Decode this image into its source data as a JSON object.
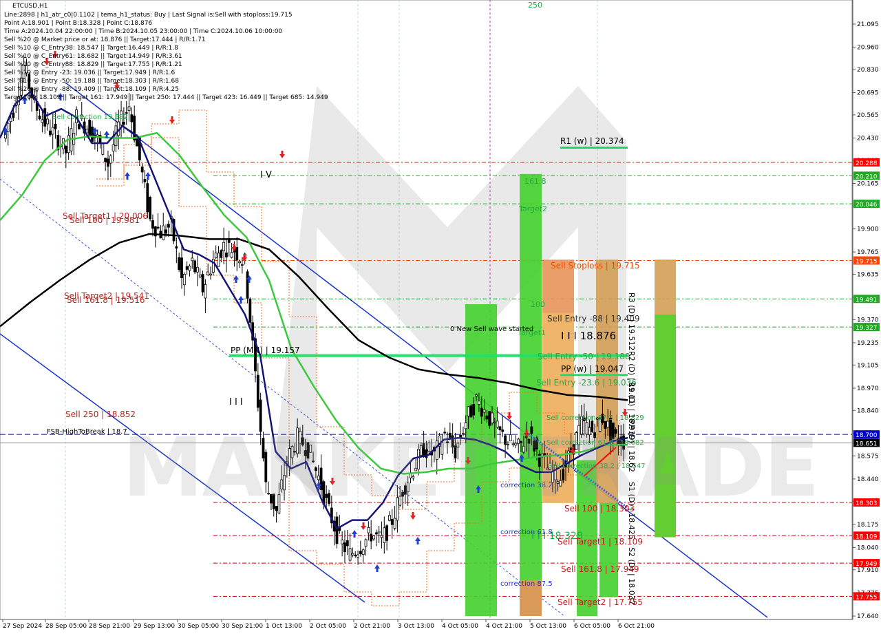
{
  "chart_data": {
    "type": "line",
    "title": "ETCUSD,H1",
    "info_lines": [
      "Line:2898 | h1_atr_c0|0.1102 | tema_h1_status: Buy | Last Signal is:Sell with stoploss:19.715",
      "Point A:18.901 | Point B:18.328 | Point C:18.876",
      "Time A:2024.10.04 22:00:00 | Time B:2024.10.05 23:00:00 | Time C:2024.10.06 10:00:00",
      "Sell %20 @ Market price or at: 18.876 || Target:17.444 | R/R:1.71",
      "Sell %10 @ C_Entry38: 18.547 || Target:16.449 | R/R:1.8",
      "Sell %10 @ C_Entry61: 18.682 || Target:14.949 | R/R:3.61",
      "Sell %10 @ C_Entry88: 18.829 || Target:17.755 | R/R:1.21",
      "Sell %10 @ Entry -23: 19.036 || Target:17.949 | R/R:1.6",
      "Sell %10 @ Entry -50: 19.188 || Target:18.303 | R/R:1.68",
      "Sell %20 @ Entry -88: 19.409 || Target:18.109 | R/R:4.25",
      "Target100: 18.109 || Target 161: 17.949 || Target 250: 17.444 || Target 423: 16.449 || Target 685: 14.949"
    ],
    "x_labels": [
      "27 Sep 2024",
      "28 Sep 05:00",
      "28 Sep 21:00",
      "29 Sep 13:00",
      "30 Sep 05:00",
      "30 Sep 21:00",
      "1 Oct 13:00",
      "2 Oct 05:00",
      "2 Oct 21:00",
      "3 Oct 13:00",
      "4 Oct 05:00",
      "4 Oct 21:00",
      "5 Oct 13:00",
      "6 Oct 05:00",
      "6 Oct 21:00"
    ],
    "y_ticks": [
      21.095,
      20.96,
      20.83,
      20.695,
      20.565,
      20.43,
      20.3,
      20.165,
      20.035,
      19.9,
      19.765,
      19.635,
      19.5,
      19.37,
      19.235,
      19.105,
      18.97,
      18.84,
      18.705,
      18.575,
      18.44,
      18.31,
      18.175,
      18.04,
      17.91,
      17.775,
      17.64
    ],
    "price_tags": [
      {
        "label": "20.288",
        "value": 20.288,
        "color": "#ff0000"
      },
      {
        "label": "20.210",
        "value": 20.21,
        "color": "#22aa22"
      },
      {
        "label": "20.046",
        "value": 20.046,
        "color": "#22aa22"
      },
      {
        "label": "19.715",
        "value": 19.715,
        "color": "#ff4500"
      },
      {
        "label": "19.491",
        "value": 19.491,
        "color": "#22aa22"
      },
      {
        "label": "19.327",
        "value": 19.327,
        "color": "#22aa22"
      },
      {
        "label": "18.700",
        "value": 18.7,
        "color": "#0000cd"
      },
      {
        "label": "18.651",
        "value": 18.651,
        "color": "#000000"
      },
      {
        "label": "18.303",
        "value": 18.303,
        "color": "#ff0000"
      },
      {
        "label": "18.109",
        "value": 18.109,
        "color": "#ff0000"
      },
      {
        "label": "17.949",
        "value": 17.949,
        "color": "#ff0000"
      },
      {
        "label": "17.755",
        "value": 17.755,
        "color": "#ff0000"
      }
    ],
    "annotations": {
      "r1_week": "R1 (w) | 20.374",
      "pp_month": "PP (MN) | 19.157",
      "pp_week": "PP (w) | 19.047",
      "sell_target1_top": "Sell Target1 | 20.006",
      "sell_100_top": "Sell 100 | 19.981",
      "sell_target2_top": "Sell Target2 | 19.541",
      "sell_161_top": "Sell 161.8 | 19.516",
      "sell_250": "Sell  250 | 18.852",
      "fsb": "FSB-HighToBreak | 18.7",
      "sell_stoploss": "Sell Stoploss | 19.715",
      "sell_entry_88": "Sell Entry -88 | 19.409",
      "sell_entry_50": "Sell Entry -50 | 19.188",
      "sell_entry_23": "Sell Entry -23.6 | 19.036",
      "point_c": "I I I 18.876",
      "point_b": "I I I 18.328",
      "sell_correction_87": "Sell correction 87.5 | 18.829",
      "sell_correction_61": "Sell correction 61.8 | 18.682",
      "sell_correction_38": "Sell correction 38.2 | 18.547",
      "sell_100_bottom": "Sell 100 | 18.303",
      "sell_target1_bottom": "Sell Target1 | 18.109",
      "sell_161_bottom": "Sell 161.8 | 17.949",
      "sell_target2_bottom": "Sell Target2 | 17.755",
      "correction_38": "correction 38.2",
      "correction_61": "correction 61.8",
      "correction_87": "correction 87.5",
      "new_wave": "0 New Sell wave started",
      "sell_correction_left": "Sell correction 19.582",
      "target1": "Target1",
      "target2": "Target2",
      "fib_100": "100",
      "fib_161": "161.8",
      "fib_250": "250",
      "wave_iv": "I V",
      "wave_iii": "I I I",
      "r3_daily": "R3 (D) | 19.512",
      "r2_daily": "R2 (D) | 19.11",
      "r1_daily": "R1 (D) | 18.939",
      "pp_daily": "PP (D) | 18.62",
      "s1_daily": "S1 (D) | 18.425",
      "s2_daily": "S2 (D) | 18.037",
      "watermark": "MARKET TRADE"
    },
    "series": [
      {
        "name": "price",
        "values": [
          20.43,
          20.6,
          20.85,
          20.63,
          20.52,
          20.44,
          20.35,
          20.55,
          20.5,
          20.42,
          20.28,
          20.5,
          20.62,
          20.3,
          19.95,
          19.88,
          19.92,
          19.6,
          19.7,
          19.55,
          19.72,
          19.8,
          19.78,
          19.7,
          19.05,
          18.4,
          18.25,
          18.55,
          18.68,
          18.62,
          18.45,
          18.25,
          18.08,
          18.0,
          18.05,
          18.12,
          18.08,
          18.2,
          18.38,
          18.5,
          18.62,
          18.58,
          18.7,
          18.6,
          18.78,
          18.9,
          18.82,
          18.72,
          18.66,
          18.62,
          18.7,
          18.57,
          18.48,
          18.45,
          18.6,
          18.76,
          18.72,
          18.8,
          18.68,
          18.66
        ]
      },
      {
        "name": "ma_fast_navy",
        "values": [
          20.43,
          20.63,
          20.7,
          20.56,
          20.6,
          20.55,
          20.4,
          20.4,
          20.5,
          20.44,
          20.22,
          20.0,
          19.78,
          19.75,
          19.7,
          19.55,
          19.4,
          19.16,
          18.6,
          18.5,
          18.54,
          18.32,
          18.15,
          18.2,
          18.2,
          18.3,
          18.46,
          18.56,
          18.58,
          18.67,
          18.68,
          18.67,
          18.64,
          18.6,
          18.52,
          18.48,
          18.48,
          18.53,
          18.58,
          18.62,
          18.66,
          18.68
        ]
      },
      {
        "name": "ma_mid_green",
        "values": [
          19.95,
          20.1,
          20.3,
          20.42,
          20.44,
          20.43,
          20.43,
          20.46,
          20.33,
          20.15,
          19.98,
          19.85,
          19.6,
          19.2,
          18.98,
          18.78,
          18.62,
          18.5,
          18.47,
          18.48,
          18.5,
          18.5,
          18.53,
          18.55,
          18.57,
          18.58,
          18.6,
          18.64,
          18.64
        ]
      },
      {
        "name": "ma_slow_black",
        "values": [
          19.33,
          19.47,
          19.6,
          19.72,
          19.82,
          19.87,
          19.86,
          19.84,
          19.84,
          19.78,
          19.62,
          19.43,
          19.25,
          19.15,
          19.08,
          19.05,
          19.03,
          19.0,
          18.96,
          18.93,
          18.92,
          18.9
        ]
      }
    ]
  }
}
